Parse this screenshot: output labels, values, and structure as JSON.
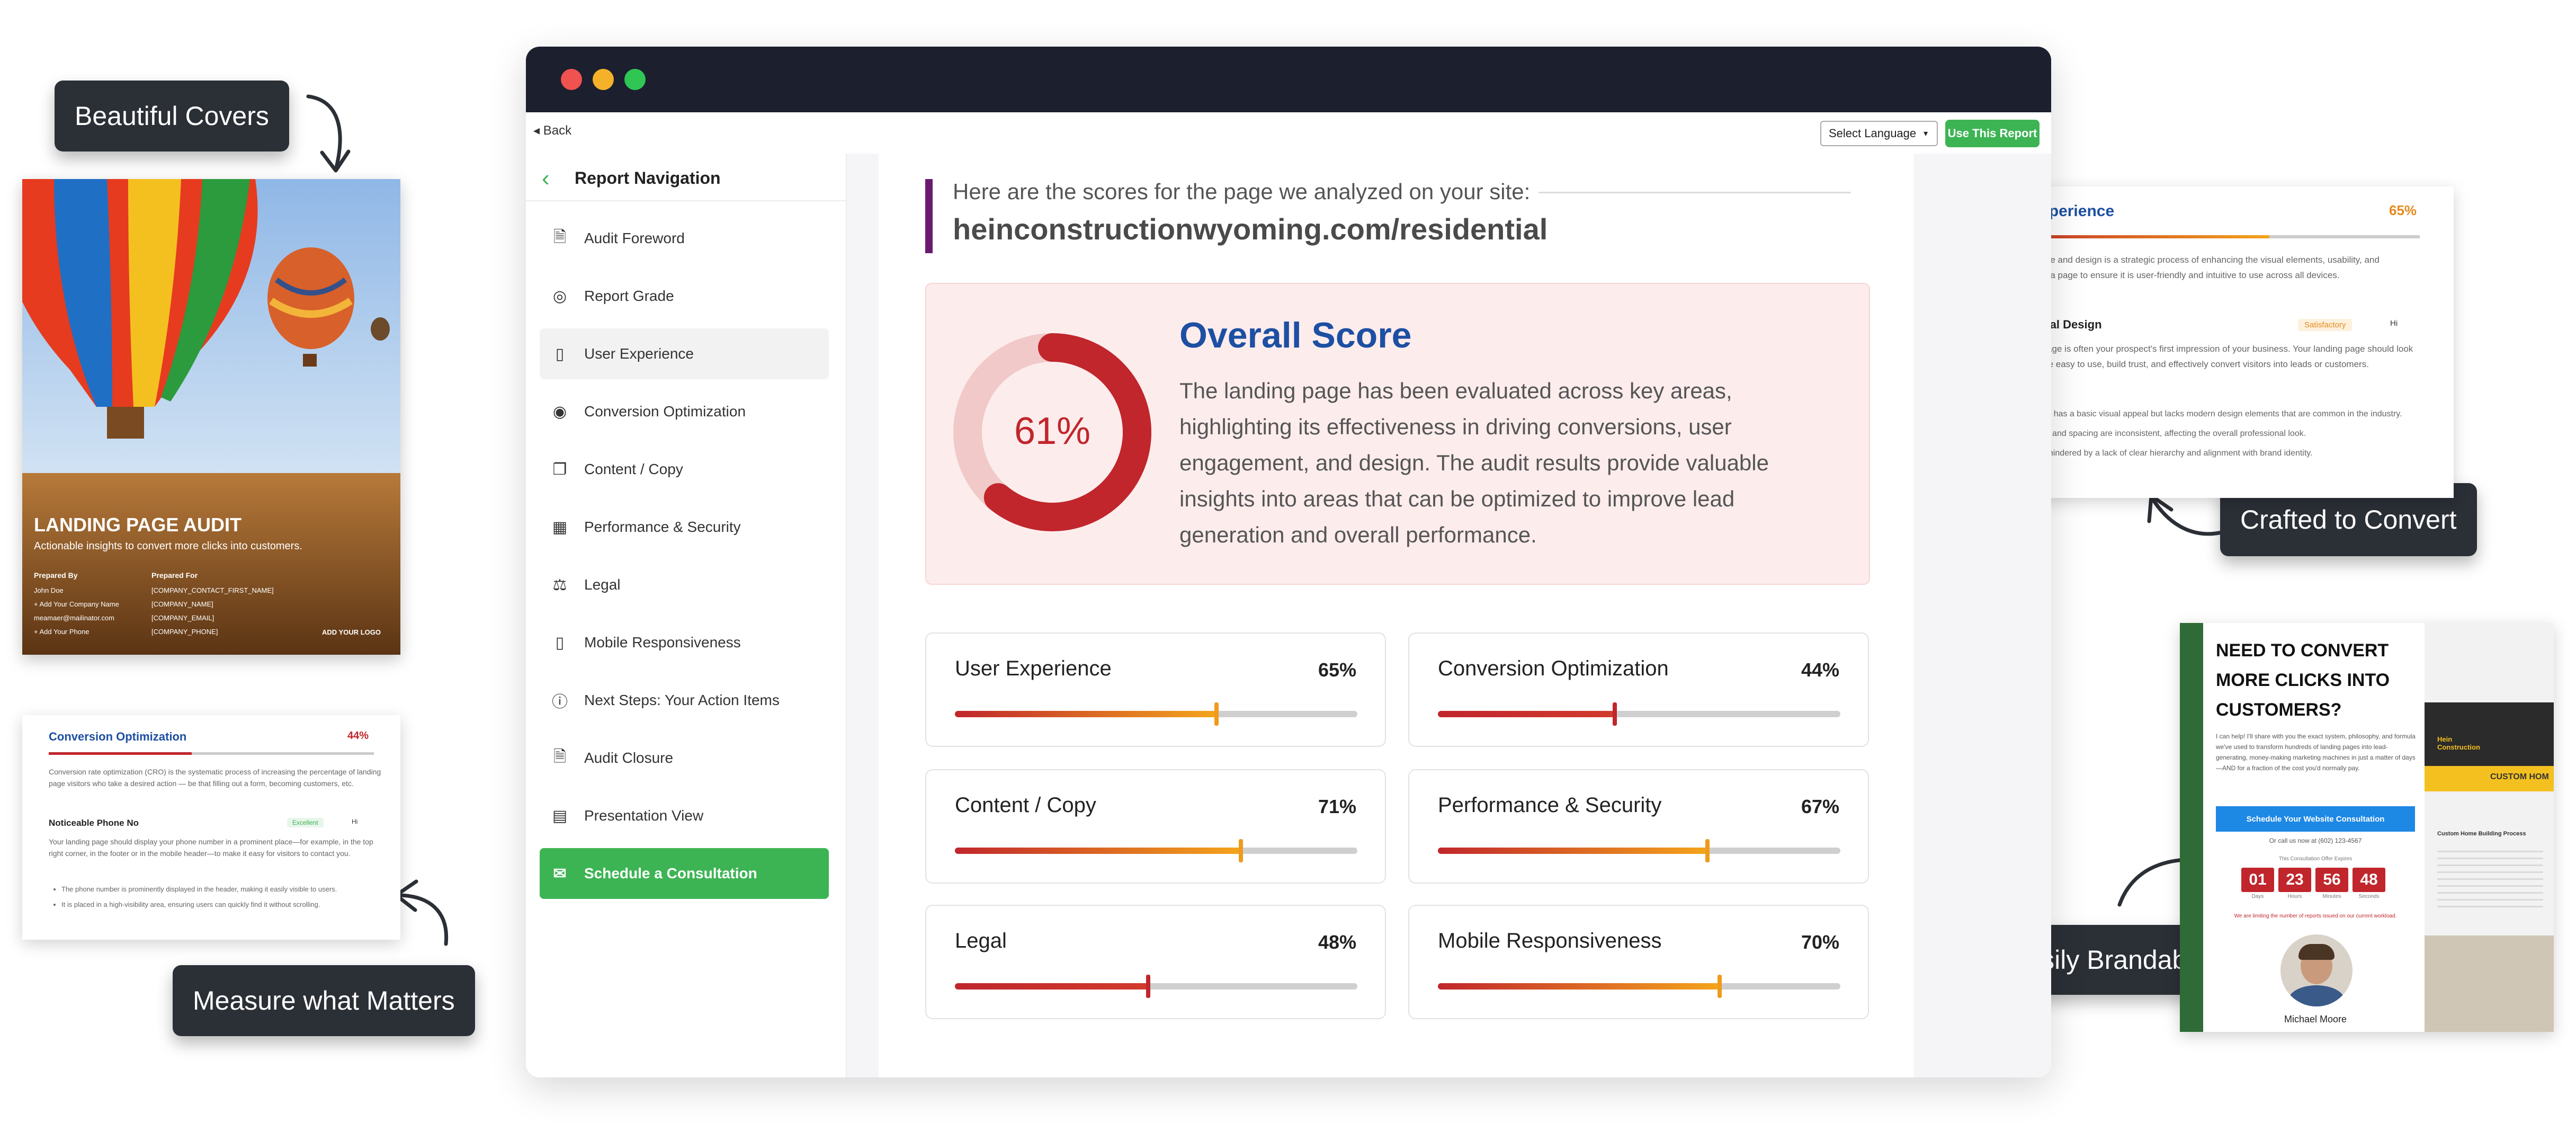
{
  "tags": {
    "beautiful_covers": "Beautiful Covers",
    "crafted": "Crafted to Convert",
    "brandable": "Easily Brandable",
    "measure": "Measure what Matters"
  },
  "window": {
    "back": "Back",
    "language": "Select Language",
    "use_report": "Use This Report"
  },
  "sidebar": {
    "title": "Report Navigation",
    "items": [
      {
        "label": "Audit Foreword",
        "icon": "document-icon"
      },
      {
        "label": "Report Grade",
        "icon": "grade-icon"
      },
      {
        "label": "User Experience",
        "icon": "mobile-icon"
      },
      {
        "label": "Conversion Optimization",
        "icon": "target-icon"
      },
      {
        "label": "Content / Copy",
        "icon": "copy-icon"
      },
      {
        "label": "Performance & Security",
        "icon": "speed-icon"
      },
      {
        "label": "Legal",
        "icon": "gavel-icon"
      },
      {
        "label": "Mobile Responsiveness",
        "icon": "phone-icon"
      },
      {
        "label": "Next Steps: Your Action Items",
        "icon": "info-icon"
      },
      {
        "label": "Audit Closure",
        "icon": "document-icon"
      },
      {
        "label": "Presentation View",
        "icon": "presentation-icon"
      },
      {
        "label": "Schedule a Consultation",
        "icon": "chat-icon"
      }
    ]
  },
  "main": {
    "intro": "Here are the scores for the page we analyzed on your site:",
    "url": "heinconstructionwyoming.com/residential",
    "overall_title": "Overall Score",
    "overall_value": "61%",
    "overall_fraction": 0.61,
    "overall_desc": "The landing page has been evaluated across key areas, highlighting its effectiveness in driving conversions, user engagement, and design. The audit results provide valuable insights into areas that can be optimized to improve lead generation and overall performance.",
    "scores": [
      {
        "name": "User Experience",
        "value": 65,
        "label": "65%"
      },
      {
        "name": "Conversion Optimization",
        "value": 44,
        "label": "44%"
      },
      {
        "name": "Content / Copy",
        "value": 71,
        "label": "71%"
      },
      {
        "name": "Performance & Security",
        "value": 67,
        "label": "67%"
      },
      {
        "name": "Legal",
        "value": 48,
        "label": "48%"
      },
      {
        "name": "Mobile Responsiveness",
        "value": 70,
        "label": "70%"
      }
    ]
  },
  "cover": {
    "title": "LANDING PAGE AUDIT",
    "subtitle": "Actionable insights to convert more clicks into customers.",
    "prepared_by": "Prepared By",
    "prepared_for": "Prepared For",
    "by_lines": [
      "John Doe",
      "+ Add Your Company Name",
      "meamaer@mailinator.com",
      "+ Add Your Phone"
    ],
    "for_lines": [
      "[COMPANY_CONTACT_FIRST_NAME]",
      "[COMPANY_NAME]",
      "[COMPANY_EMAIL]",
      "[COMPANY_PHONE]"
    ],
    "logo": "ADD YOUR LOGO"
  },
  "ux_card": {
    "title": "User Experience",
    "pct": "65%",
    "value": 65,
    "intro": "User experience and design is a strategic process of enhancing the visual elements, usability, and accessibility of a page to ensure it is user-friendly and intuitive to use across all devices.",
    "sub": "Professional Design",
    "badge": "Satisfactory",
    "badge2": "Hi",
    "body": "Your landing page is often your prospect's first impression of your business. Your landing page should look professional, be easy to use, build trust, and effectively convert visitors into leads or customers.",
    "bullets": [
      "The website has a basic visual appeal but lacks modern design elements that are common in the industry.",
      "Typography and spacing are inconsistent, affecting the overall professional look.",
      "Usability is hindered by a lack of clear hierarchy and alignment with brand identity."
    ]
  },
  "co_card": {
    "title": "Conversion Optimization",
    "pct": "44%",
    "value": 44,
    "intro": "Conversion rate optimization (CRO) is the systematic process of increasing the percentage of landing page visitors who take a desired action — be that filling out a form, becoming customers, etc.",
    "sub": "Noticeable Phone No",
    "badge": "Excellent",
    "badge2": "Hi",
    "body": "Your landing page should display your phone number in a prominent place—for example, in the top right corner, in the footer or in the mobile header—to make it easy for visitors to contact you.",
    "bullets": [
      "The phone number is prominently displayed in the header, making it easily visible to users.",
      "It is placed in a high-visibility area, ensuring users can quickly find it without scrolling."
    ]
  },
  "brand_card": {
    "headline": "NEED TO CONVERT MORE CLICKS INTO CUSTOMERS?",
    "body": "I can help! I'll share with you the exact system, philosophy, and formula we've used to transform hundreds of landing pages into lead-generating, money-making marketing machines in just a matter of days—AND for a fraction of the cost you'd normally pay.",
    "button": "Schedule Your Website Consultation",
    "call": "Or call us now at (602) 123-4567",
    "offer": "This Consultation Offer Expires",
    "countdown": [
      {
        "v": "01",
        "l": "Days"
      },
      {
        "v": "23",
        "l": "Hours"
      },
      {
        "v": "56",
        "l": "Minutes"
      },
      {
        "v": "48",
        "l": "Seconds"
      }
    ],
    "limit": "We are limiting the number of reports issued on our current workload.",
    "person": "Michael Moore",
    "site_brand": "Hein Construction",
    "site_tag": "CUSTOM HOM",
    "site_heading": "Custom Home Building Process"
  },
  "colors": {
    "accent_green": "#3db454",
    "score_red": "#c0262c",
    "brand_blue": "#1d4fa3",
    "window_dark": "#1b1f2e"
  }
}
